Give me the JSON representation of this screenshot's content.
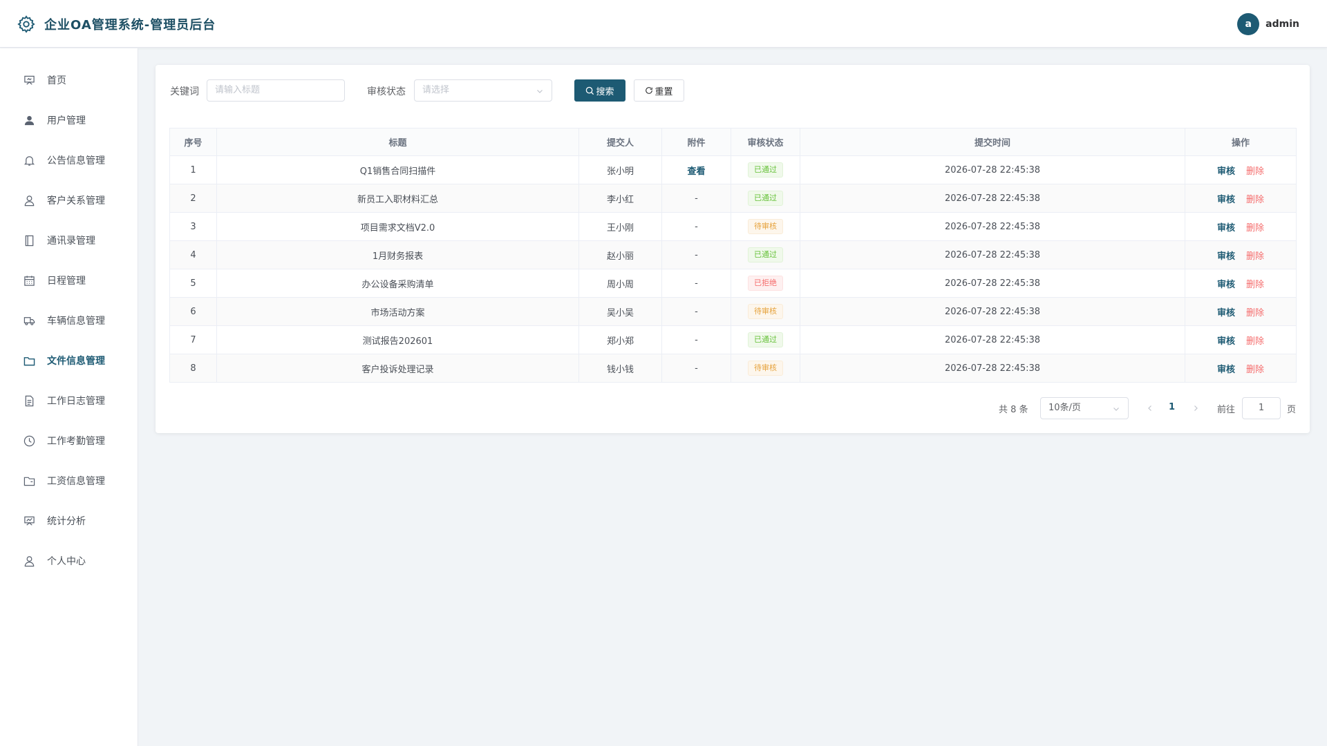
{
  "app": {
    "title": "企业OA管理系统-管理员后台"
  },
  "user": {
    "avatar_letter": "a",
    "name": "admin"
  },
  "colors": {
    "primary": "#1d5a73",
    "approved": "#67c23a",
    "pending": "#e6a23c",
    "rejected": "#f56c6c"
  },
  "sidebar": {
    "items": [
      {
        "label": "首页",
        "icon": "home-icon"
      },
      {
        "label": "用户管理",
        "icon": "user-icon"
      },
      {
        "label": "公告信息管理",
        "icon": "bell-icon"
      },
      {
        "label": "客户关系管理",
        "icon": "person-icon"
      },
      {
        "label": "通讯录管理",
        "icon": "notebook-icon"
      },
      {
        "label": "日程管理",
        "icon": "calendar-icon"
      },
      {
        "label": "车辆信息管理",
        "icon": "truck-icon"
      },
      {
        "label": "文件信息管理",
        "icon": "folder-icon",
        "active": true
      },
      {
        "label": "工作日志管理",
        "icon": "document-icon"
      },
      {
        "label": "工作考勤管理",
        "icon": "clock-icon"
      },
      {
        "label": "工资信息管理",
        "icon": "wallet-icon"
      },
      {
        "label": "统计分析",
        "icon": "chart-icon"
      },
      {
        "label": "个人中心",
        "icon": "person-icon"
      }
    ]
  },
  "filters": {
    "keyword_label": "关键词",
    "keyword_placeholder": "请输入标题",
    "status_label": "审核状态",
    "status_placeholder": "请选择",
    "search_button": "搜索",
    "reset_button": "重置"
  },
  "table": {
    "columns": [
      "序号",
      "标题",
      "提交人",
      "附件",
      "审核状态",
      "提交时间",
      "操作"
    ],
    "rows": [
      {
        "no": "1",
        "title": "Q1销售合同扫描件",
        "submitter": "张小明",
        "attachment": "查看",
        "status": "已通过",
        "status_type": "approved",
        "time": "2026-07-28 22:45:38"
      },
      {
        "no": "2",
        "title": "新员工入职材料汇总",
        "submitter": "李小红",
        "attachment": "-",
        "status": "已通过",
        "status_type": "approved",
        "time": "2026-07-28 22:45:38"
      },
      {
        "no": "3",
        "title": "项目需求文档V2.0",
        "submitter": "王小刚",
        "attachment": "-",
        "status": "待审核",
        "status_type": "pending",
        "time": "2026-07-28 22:45:38"
      },
      {
        "no": "4",
        "title": "1月财务报表",
        "submitter": "赵小丽",
        "attachment": "-",
        "status": "已通过",
        "status_type": "approved",
        "time": "2026-07-28 22:45:38"
      },
      {
        "no": "5",
        "title": "办公设备采购清单",
        "submitter": "周小周",
        "attachment": "-",
        "status": "已拒绝",
        "status_type": "rejected",
        "time": "2026-07-28 22:45:38"
      },
      {
        "no": "6",
        "title": "市场活动方案",
        "submitter": "吴小吴",
        "attachment": "-",
        "status": "待审核",
        "status_type": "pending",
        "time": "2026-07-28 22:45:38"
      },
      {
        "no": "7",
        "title": "测试报告202601",
        "submitter": "郑小郑",
        "attachment": "-",
        "status": "已通过",
        "status_type": "approved",
        "time": "2026-07-28 22:45:38"
      },
      {
        "no": "8",
        "title": "客户投诉处理记录",
        "submitter": "钱小钱",
        "attachment": "-",
        "status": "待审核",
        "status_type": "pending",
        "time": "2026-07-28 22:45:38"
      }
    ],
    "review_label": "审核",
    "delete_label": "删除"
  },
  "pagination": {
    "total": "共 8 条",
    "page_size": "10条/页",
    "current_page": "1",
    "goto_label": "前往",
    "goto_value": "1",
    "page_suffix": "页"
  }
}
